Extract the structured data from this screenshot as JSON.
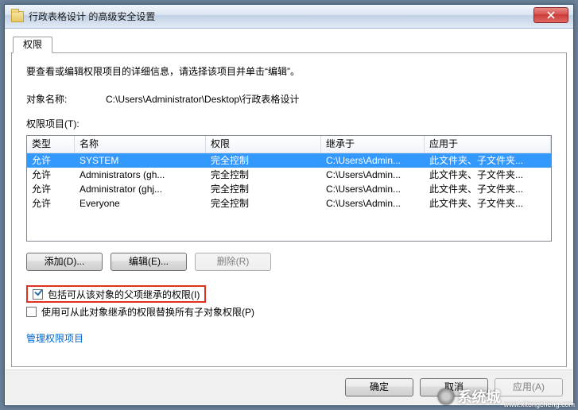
{
  "window": {
    "title": "行政表格设计 的高级安全设置"
  },
  "tab": {
    "label": "权限"
  },
  "hint": "要查看或编辑权限项目的详细信息，请选择该项目并单击“编辑”。",
  "object": {
    "label": "对象名称:",
    "value": "C:\\Users\\Administrator\\Desktop\\行政表格设计"
  },
  "list_label": "权限项目(T):",
  "columns": {
    "c0": "类型",
    "c1": "名称",
    "c2": "权限",
    "c3": "继承于",
    "c4": "应用于"
  },
  "rows": [
    {
      "c0": "允许",
      "c1": "SYSTEM",
      "c2": "完全控制",
      "c3": "C:\\Users\\Admin...",
      "c4": "此文件夹、子文件夹...",
      "selected": true
    },
    {
      "c0": "允许",
      "c1": "Administrators (gh...",
      "c2": "完全控制",
      "c3": "C:\\Users\\Admin...",
      "c4": "此文件夹、子文件夹...",
      "selected": false
    },
    {
      "c0": "允许",
      "c1": "Administrator (ghj...",
      "c2": "完全控制",
      "c3": "C:\\Users\\Admin...",
      "c4": "此文件夹、子文件夹...",
      "selected": false
    },
    {
      "c0": "允许",
      "c1": "Everyone",
      "c2": "完全控制",
      "c3": "C:\\Users\\Admin...",
      "c4": "此文件夹、子文件夹...",
      "selected": false
    }
  ],
  "buttons": {
    "add": "添加(D)...",
    "edit": "编辑(E)...",
    "remove": "删除(R)"
  },
  "checks": {
    "inherit": {
      "label": "包括可从该对象的父项继承的权限(I)",
      "checked": true
    },
    "replace": {
      "label": "使用可从此对象继承的权限替换所有子对象权限(P)",
      "checked": false
    }
  },
  "link": "管理权限项目",
  "footer": {
    "ok": "确定",
    "cancel": "取消",
    "apply": "应用(A)"
  },
  "watermark": {
    "text": "系统城",
    "url": "www.xitongcheng.com"
  }
}
